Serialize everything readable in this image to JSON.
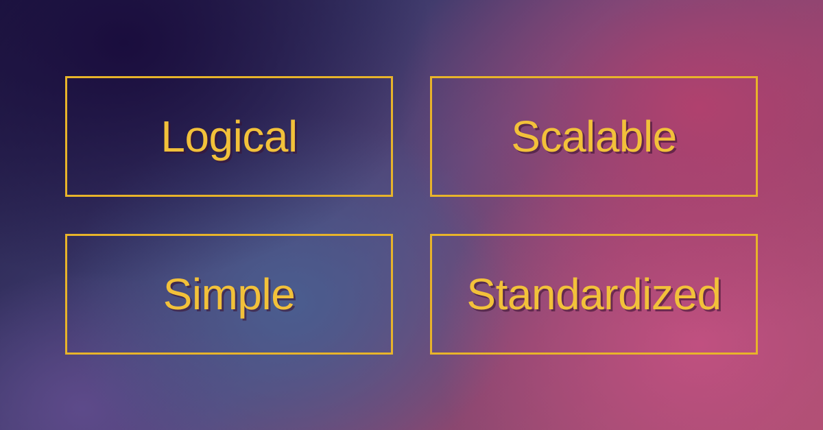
{
  "cards": [
    {
      "label": "Logical"
    },
    {
      "label": "Scalable"
    },
    {
      "label": "Simple"
    },
    {
      "label": "Standardized"
    }
  ],
  "colors": {
    "border": "#e8b42a",
    "text": "#f2c13a"
  }
}
